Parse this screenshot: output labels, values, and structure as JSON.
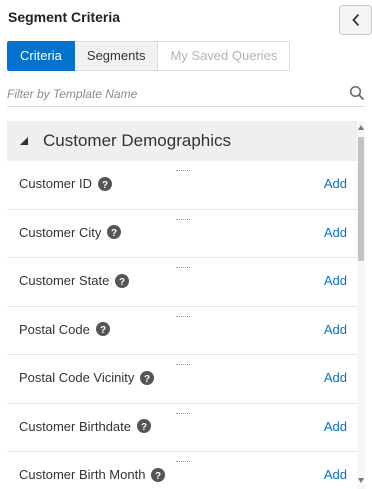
{
  "panel": {
    "title": "Segment Criteria",
    "collapse_icon": "chevron-left-icon"
  },
  "tabs": [
    {
      "label": "Criteria",
      "state": "active"
    },
    {
      "label": "Segments",
      "state": "normal"
    },
    {
      "label": "My Saved Queries",
      "state": "disabled"
    }
  ],
  "filter": {
    "placeholder": "Filter by Template Name",
    "value": ""
  },
  "group": {
    "label": "Customer Demographics",
    "expanded": true
  },
  "criteria": [
    {
      "label": "Customer ID",
      "action": "Add"
    },
    {
      "label": "Customer City",
      "action": "Add"
    },
    {
      "label": "Customer State",
      "action": "Add"
    },
    {
      "label": "Postal Code",
      "action": "Add"
    },
    {
      "label": "Postal Code Vicinity",
      "action": "Add"
    },
    {
      "label": "Customer Birthdate",
      "action": "Add"
    },
    {
      "label": "Customer Birth Month",
      "action": "Add"
    }
  ],
  "colors": {
    "accent": "#0572ce",
    "group_bg": "#efefef",
    "help_icon": "#555555"
  }
}
